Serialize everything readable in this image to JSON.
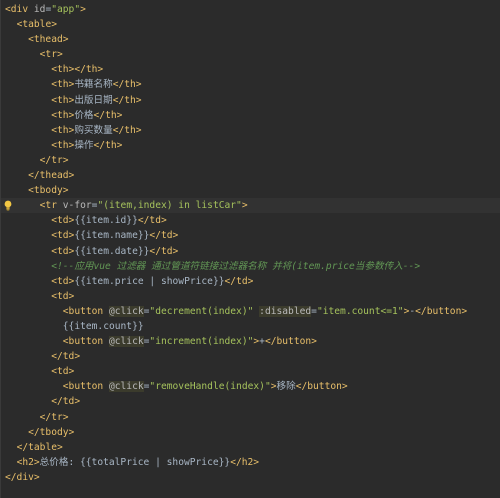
{
  "editor": {
    "lines": [
      [
        {
          "t": "tag",
          "v": "<div "
        },
        {
          "t": "attr",
          "v": "id"
        },
        {
          "t": "txt",
          "v": "="
        },
        {
          "t": "str",
          "v": "\"app\""
        },
        {
          "t": "tag",
          "v": ">"
        }
      ],
      [
        {
          "t": "txt",
          "v": "  "
        },
        {
          "t": "tag",
          "v": "<table>"
        }
      ],
      [
        {
          "t": "txt",
          "v": "    "
        },
        {
          "t": "tag",
          "v": "<thead>"
        }
      ],
      [
        {
          "t": "txt",
          "v": "      "
        },
        {
          "t": "tag",
          "v": "<tr>"
        }
      ],
      [
        {
          "t": "txt",
          "v": "        "
        },
        {
          "t": "tag",
          "v": "<th></th>"
        }
      ],
      [
        {
          "t": "txt",
          "v": "        "
        },
        {
          "t": "tag",
          "v": "<th>"
        },
        {
          "t": "txt",
          "v": "书籍名称"
        },
        {
          "t": "tag",
          "v": "</th>"
        }
      ],
      [
        {
          "t": "txt",
          "v": "        "
        },
        {
          "t": "tag",
          "v": "<th>"
        },
        {
          "t": "txt",
          "v": "出版日期"
        },
        {
          "t": "tag",
          "v": "</th>"
        }
      ],
      [
        {
          "t": "txt",
          "v": "        "
        },
        {
          "t": "tag",
          "v": "<th>"
        },
        {
          "t": "txt",
          "v": "价格"
        },
        {
          "t": "tag",
          "v": "</th>"
        }
      ],
      [
        {
          "t": "txt",
          "v": "        "
        },
        {
          "t": "tag",
          "v": "<th>"
        },
        {
          "t": "txt",
          "v": "购买数量"
        },
        {
          "t": "tag",
          "v": "</th>"
        }
      ],
      [
        {
          "t": "txt",
          "v": "        "
        },
        {
          "t": "tag",
          "v": "<th>"
        },
        {
          "t": "txt",
          "v": "操作"
        },
        {
          "t": "tag",
          "v": "</th>"
        }
      ],
      [
        {
          "t": "txt",
          "v": "      "
        },
        {
          "t": "tag",
          "v": "</tr>"
        }
      ],
      [
        {
          "t": "txt",
          "v": "    "
        },
        {
          "t": "tag",
          "v": "</thead>"
        }
      ],
      [
        {
          "t": "txt",
          "v": "    "
        },
        {
          "t": "tag",
          "v": "<tbody>"
        }
      ],
      [
        {
          "t": "txt",
          "v": "      "
        },
        {
          "t": "tag",
          "v": "<tr "
        },
        {
          "t": "attr",
          "v": "v-for"
        },
        {
          "t": "txt",
          "v": "="
        },
        {
          "t": "str",
          "v": "\"(item,index) in listCar\""
        },
        {
          "t": "tag",
          "v": ">"
        }
      ],
      [
        {
          "t": "txt",
          "v": "        "
        },
        {
          "t": "tag",
          "v": "<td>"
        },
        {
          "t": "txt",
          "v": "{{item.id}}"
        },
        {
          "t": "tag",
          "v": "</td>"
        }
      ],
      [
        {
          "t": "txt",
          "v": "        "
        },
        {
          "t": "tag",
          "v": "<td>"
        },
        {
          "t": "txt",
          "v": "{{item.name}}"
        },
        {
          "t": "tag",
          "v": "</td>"
        }
      ],
      [
        {
          "t": "txt",
          "v": "        "
        },
        {
          "t": "tag",
          "v": "<td>"
        },
        {
          "t": "txt",
          "v": "{{item.date}}"
        },
        {
          "t": "tag",
          "v": "</td>"
        }
      ],
      [
        {
          "t": "txt",
          "v": "        "
        },
        {
          "t": "cmt",
          "v": "<!--应用vue 过滤器 通过管道符链接过滤器名称 并将(item.price当参数传入-->"
        }
      ],
      [
        {
          "t": "txt",
          "v": "        "
        },
        {
          "t": "tag",
          "v": "<td>"
        },
        {
          "t": "txt",
          "v": "{{item.price | showPrice}}"
        },
        {
          "t": "tag",
          "v": "</td>"
        }
      ],
      [
        {
          "t": "txt",
          "v": "        "
        },
        {
          "t": "tag",
          "v": "<td>"
        }
      ],
      [
        {
          "t": "txt",
          "v": "          "
        },
        {
          "t": "tag",
          "v": "<button "
        },
        {
          "t": "dir",
          "v": "@click"
        },
        {
          "t": "txt",
          "v": "="
        },
        {
          "t": "str",
          "v": "\"decrement(index)\""
        },
        {
          "t": "txt",
          "v": " "
        },
        {
          "t": "dir",
          "v": ":disabled"
        },
        {
          "t": "txt",
          "v": "="
        },
        {
          "t": "str",
          "v": "\"item.count<=1\""
        },
        {
          "t": "tag",
          "v": ">"
        },
        {
          "t": "txt",
          "v": "-"
        },
        {
          "t": "tag",
          "v": "</button>"
        }
      ],
      [
        {
          "t": "txt",
          "v": "          "
        },
        {
          "t": "txt",
          "v": "{{item.count}}"
        }
      ],
      [
        {
          "t": "txt",
          "v": "          "
        },
        {
          "t": "tag",
          "v": "<button "
        },
        {
          "t": "dir",
          "v": "@click"
        },
        {
          "t": "txt",
          "v": "="
        },
        {
          "t": "str",
          "v": "\"increment(index)\""
        },
        {
          "t": "tag",
          "v": ">"
        },
        {
          "t": "txt",
          "v": "+"
        },
        {
          "t": "tag",
          "v": "</button>"
        }
      ],
      [
        {
          "t": "txt",
          "v": "        "
        },
        {
          "t": "tag",
          "v": "</td>"
        }
      ],
      [
        {
          "t": "txt",
          "v": "        "
        },
        {
          "t": "tag",
          "v": "<td>"
        }
      ],
      [
        {
          "t": "txt",
          "v": "          "
        },
        {
          "t": "tag",
          "v": "<button "
        },
        {
          "t": "dir",
          "v": "@click"
        },
        {
          "t": "txt",
          "v": "="
        },
        {
          "t": "str",
          "v": "\"removeHandle(index)\""
        },
        {
          "t": "tag",
          "v": ">"
        },
        {
          "t": "txt",
          "v": "移除"
        },
        {
          "t": "tag",
          "v": "</button>"
        }
      ],
      [
        {
          "t": "txt",
          "v": "        "
        },
        {
          "t": "tag",
          "v": "</td>"
        }
      ],
      [
        {
          "t": "txt",
          "v": "      "
        },
        {
          "t": "tag",
          "v": "</tr>"
        }
      ],
      [
        {
          "t": "txt",
          "v": "    "
        },
        {
          "t": "tag",
          "v": "</tbody>"
        }
      ],
      [
        {
          "t": "txt",
          "v": "  "
        },
        {
          "t": "tag",
          "v": "</table>"
        }
      ],
      [
        {
          "t": "txt",
          "v": "  "
        },
        {
          "t": "tag",
          "v": "<h2>"
        },
        {
          "t": "txt",
          "v": "总价格: {{totalPrice | showPrice}}"
        },
        {
          "t": "tag",
          "v": "</h2>"
        }
      ],
      [
        {
          "t": "tag",
          "v": "</div>"
        }
      ]
    ],
    "current_line_index": 13,
    "gutter_icon": "lightbulb-icon",
    "colors": {
      "background": "#2b2b2b",
      "tag": "#e8bf6a",
      "attribute": "#bababa",
      "string": "#a5c25c",
      "text": "#a9b7c6",
      "comment": "#629755",
      "current_line": "#323232",
      "bulb": "#f2c744"
    }
  }
}
